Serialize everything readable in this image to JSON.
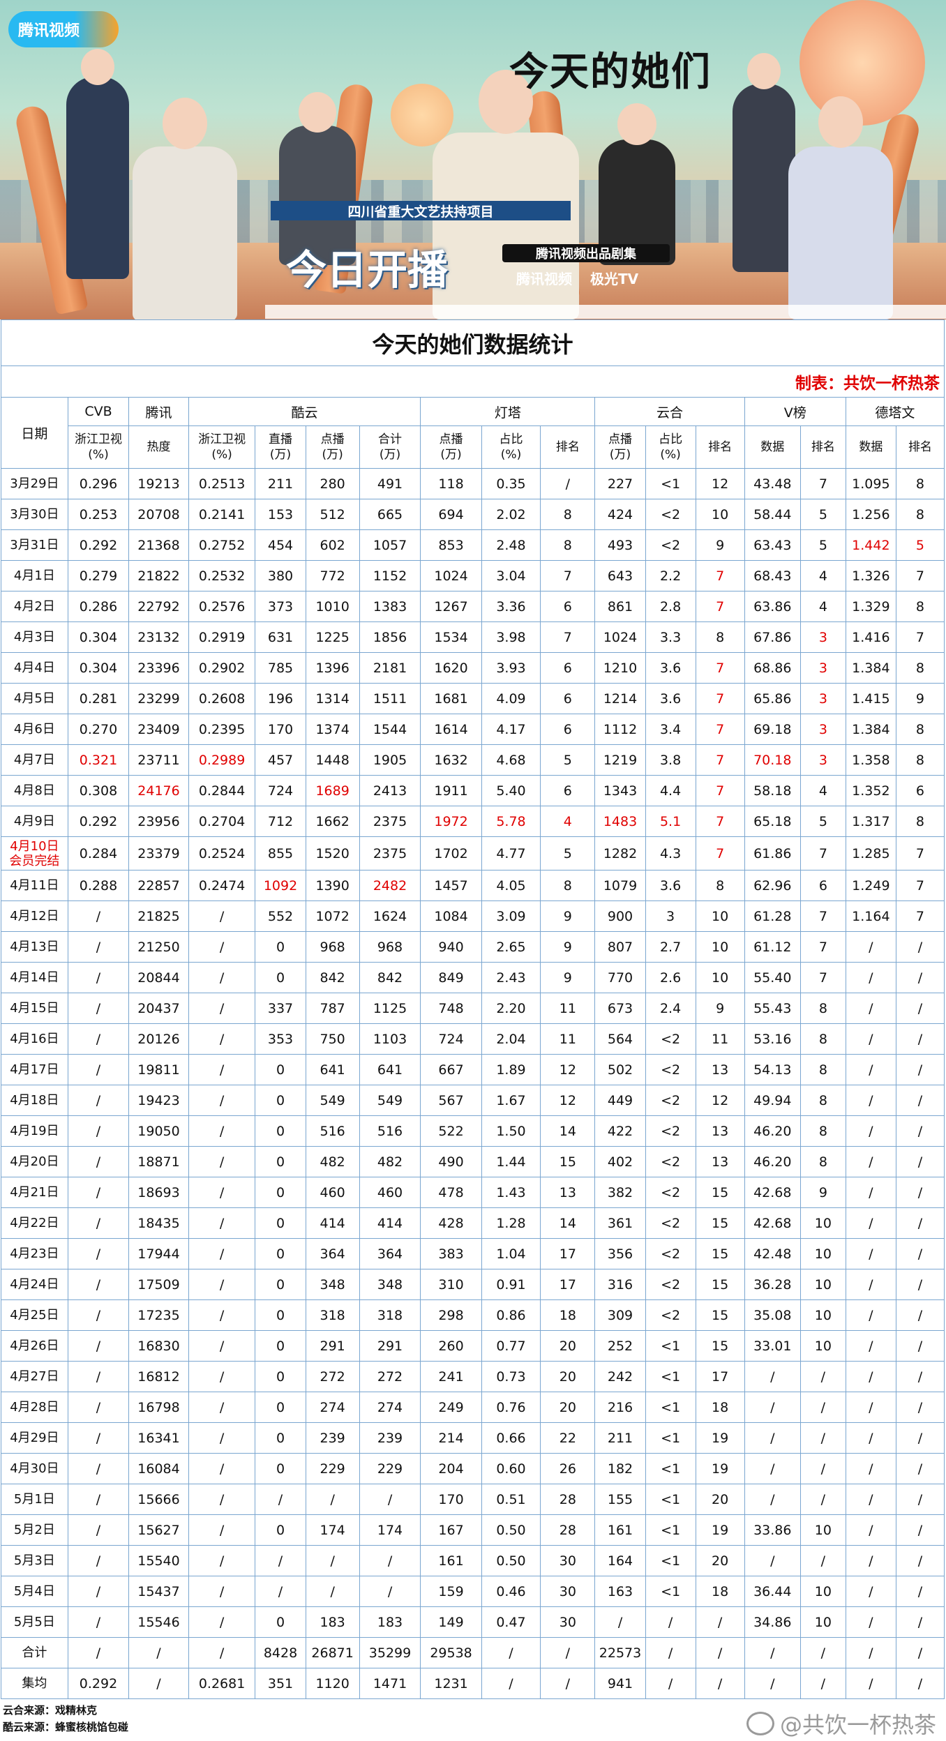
{
  "poster": {
    "platform_logo": "腾讯视频",
    "show_title": "今天的她们",
    "project_label": "四川省重大文艺扶持项目",
    "production_label": "腾讯视频出品剧集",
    "premiere_text": "今日开播",
    "brand_1": "腾讯视频",
    "brand_2": "极光TV"
  },
  "table_title": "今天的她们数据统计",
  "maker": "制表：共饮一杯热茶",
  "headers": {
    "date": "日期",
    "groups": [
      "CVB",
      "腾讯",
      "酷云",
      "灯塔",
      "云合",
      "V榜",
      "德塔文"
    ],
    "sub": [
      "浙江卫视\n(%)",
      "热度",
      "浙江卫视\n(%)",
      "直播\n(万)",
      "点播\n(万)",
      "合计\n(万)",
      "点播\n(万)",
      "占比\n(%)",
      "排名",
      "点播\n(万)",
      "占比\n(%)",
      "排名",
      "数据",
      "排名",
      "数据",
      "排名"
    ]
  },
  "red_color": "#e00000",
  "rows": [
    {
      "date": "3月29日",
      "c": [
        "0.296",
        "19213",
        "0.2513",
        "211",
        "280",
        "491",
        "118",
        "0.35",
        "/",
        "227",
        "<1",
        "12",
        "43.48",
        "7",
        "1.095",
        "8"
      ],
      "red": []
    },
    {
      "date": "3月30日",
      "c": [
        "0.253",
        "20708",
        "0.2141",
        "153",
        "512",
        "665",
        "694",
        "2.02",
        "8",
        "424",
        "<2",
        "10",
        "58.44",
        "5",
        "1.256",
        "8"
      ],
      "red": []
    },
    {
      "date": "3月31日",
      "c": [
        "0.292",
        "21368",
        "0.2752",
        "454",
        "602",
        "1057",
        "853",
        "2.48",
        "8",
        "493",
        "<2",
        "9",
        "63.43",
        "5",
        "1.442",
        "5"
      ],
      "red": [
        14,
        15
      ]
    },
    {
      "date": "4月1日",
      "c": [
        "0.279",
        "21822",
        "0.2532",
        "380",
        "772",
        "1152",
        "1024",
        "3.04",
        "7",
        "643",
        "2.2",
        "7",
        "68.43",
        "4",
        "1.326",
        "7"
      ],
      "red": [
        11
      ]
    },
    {
      "date": "4月2日",
      "c": [
        "0.286",
        "22792",
        "0.2576",
        "373",
        "1010",
        "1383",
        "1267",
        "3.36",
        "6",
        "861",
        "2.8",
        "7",
        "63.86",
        "4",
        "1.329",
        "8"
      ],
      "red": [
        11
      ]
    },
    {
      "date": "4月3日",
      "c": [
        "0.304",
        "23132",
        "0.2919",
        "631",
        "1225",
        "1856",
        "1534",
        "3.98",
        "7",
        "1024",
        "3.3",
        "8",
        "67.86",
        "3",
        "1.416",
        "7"
      ],
      "red": [
        13
      ]
    },
    {
      "date": "4月4日",
      "c": [
        "0.304",
        "23396",
        "0.2902",
        "785",
        "1396",
        "2181",
        "1620",
        "3.93",
        "6",
        "1210",
        "3.6",
        "7",
        "68.86",
        "3",
        "1.384",
        "8"
      ],
      "red": [
        11,
        13
      ]
    },
    {
      "date": "4月5日",
      "c": [
        "0.281",
        "23299",
        "0.2608",
        "196",
        "1314",
        "1511",
        "1681",
        "4.09",
        "6",
        "1214",
        "3.6",
        "7",
        "65.86",
        "3",
        "1.415",
        "9"
      ],
      "red": [
        11,
        13
      ]
    },
    {
      "date": "4月6日",
      "c": [
        "0.270",
        "23409",
        "0.2395",
        "170",
        "1374",
        "1544",
        "1614",
        "4.17",
        "6",
        "1112",
        "3.4",
        "7",
        "69.18",
        "3",
        "1.384",
        "8"
      ],
      "red": [
        11,
        13
      ]
    },
    {
      "date": "4月7日",
      "c": [
        "0.321",
        "23711",
        "0.2989",
        "457",
        "1448",
        "1905",
        "1632",
        "4.68",
        "5",
        "1219",
        "3.8",
        "7",
        "70.18",
        "3",
        "1.358",
        "8"
      ],
      "red": [
        0,
        2,
        11,
        12,
        13
      ]
    },
    {
      "date": "4月8日",
      "c": [
        "0.308",
        "24176",
        "0.2844",
        "724",
        "1689",
        "2413",
        "1911",
        "5.40",
        "6",
        "1343",
        "4.4",
        "7",
        "58.18",
        "4",
        "1.352",
        "6"
      ],
      "red": [
        1,
        4,
        11
      ]
    },
    {
      "date": "4月9日",
      "c": [
        "0.292",
        "23956",
        "0.2704",
        "712",
        "1662",
        "2375",
        "1972",
        "5.78",
        "4",
        "1483",
        "5.1",
        "7",
        "65.18",
        "5",
        "1.317",
        "8"
      ],
      "red": [
        6,
        7,
        8,
        9,
        10,
        11
      ]
    },
    {
      "date": "4月10日\n会员完结",
      "c": [
        "0.284",
        "23379",
        "0.2524",
        "855",
        "1520",
        "2375",
        "1702",
        "4.77",
        "5",
        "1282",
        "4.3",
        "7",
        "61.86",
        "7",
        "1.285",
        "7"
      ],
      "red": [
        11
      ],
      "date_red": true
    },
    {
      "date": "4月11日",
      "c": [
        "0.288",
        "22857",
        "0.2474",
        "1092",
        "1390",
        "2482",
        "1457",
        "4.05",
        "8",
        "1079",
        "3.6",
        "8",
        "62.96",
        "6",
        "1.249",
        "7"
      ],
      "red": [
        3,
        5
      ]
    },
    {
      "date": "4月12日",
      "c": [
        "/",
        "21825",
        "/",
        "552",
        "1072",
        "1624",
        "1084",
        "3.09",
        "9",
        "900",
        "3",
        "10",
        "61.28",
        "7",
        "1.164",
        "7"
      ],
      "red": []
    },
    {
      "date": "4月13日",
      "c": [
        "/",
        "21250",
        "/",
        "0",
        "968",
        "968",
        "940",
        "2.65",
        "9",
        "807",
        "2.7",
        "10",
        "61.12",
        "7",
        "/",
        "/"
      ],
      "red": []
    },
    {
      "date": "4月14日",
      "c": [
        "/",
        "20844",
        "/",
        "0",
        "842",
        "842",
        "849",
        "2.43",
        "9",
        "770",
        "2.6",
        "10",
        "55.40",
        "7",
        "/",
        "/"
      ],
      "red": []
    },
    {
      "date": "4月15日",
      "c": [
        "/",
        "20437",
        "/",
        "337",
        "787",
        "1125",
        "748",
        "2.20",
        "11",
        "673",
        "2.4",
        "9",
        "55.43",
        "8",
        "/",
        "/"
      ],
      "red": []
    },
    {
      "date": "4月16日",
      "c": [
        "/",
        "20126",
        "/",
        "353",
        "750",
        "1103",
        "724",
        "2.04",
        "11",
        "564",
        "<2",
        "11",
        "53.16",
        "8",
        "/",
        "/"
      ],
      "red": []
    },
    {
      "date": "4月17日",
      "c": [
        "/",
        "19811",
        "/",
        "0",
        "641",
        "641",
        "667",
        "1.89",
        "12",
        "502",
        "<2",
        "13",
        "54.13",
        "8",
        "/",
        "/"
      ],
      "red": []
    },
    {
      "date": "4月18日",
      "c": [
        "/",
        "19423",
        "/",
        "0",
        "549",
        "549",
        "567",
        "1.67",
        "12",
        "449",
        "<2",
        "12",
        "49.94",
        "8",
        "/",
        "/"
      ],
      "red": []
    },
    {
      "date": "4月19日",
      "c": [
        "/",
        "19050",
        "/",
        "0",
        "516",
        "516",
        "522",
        "1.50",
        "14",
        "422",
        "<2",
        "13",
        "46.20",
        "8",
        "/",
        "/"
      ],
      "red": []
    },
    {
      "date": "4月20日",
      "c": [
        "/",
        "18871",
        "/",
        "0",
        "482",
        "482",
        "490",
        "1.44",
        "15",
        "402",
        "<2",
        "13",
        "46.20",
        "8",
        "/",
        "/"
      ],
      "red": []
    },
    {
      "date": "4月21日",
      "c": [
        "/",
        "18693",
        "/",
        "0",
        "460",
        "460",
        "478",
        "1.43",
        "13",
        "382",
        "<2",
        "15",
        "42.68",
        "9",
        "/",
        "/"
      ],
      "red": []
    },
    {
      "date": "4月22日",
      "c": [
        "/",
        "18435",
        "/",
        "0",
        "414",
        "414",
        "428",
        "1.28",
        "14",
        "361",
        "<2",
        "15",
        "42.68",
        "10",
        "/",
        "/"
      ],
      "red": []
    },
    {
      "date": "4月23日",
      "c": [
        "/",
        "17944",
        "/",
        "0",
        "364",
        "364",
        "383",
        "1.04",
        "17",
        "356",
        "<2",
        "15",
        "42.48",
        "10",
        "/",
        "/"
      ],
      "red": []
    },
    {
      "date": "4月24日",
      "c": [
        "/",
        "17509",
        "/",
        "0",
        "348",
        "348",
        "310",
        "0.91",
        "17",
        "316",
        "<2",
        "15",
        "36.28",
        "10",
        "/",
        "/"
      ],
      "red": []
    },
    {
      "date": "4月25日",
      "c": [
        "/",
        "17235",
        "/",
        "0",
        "318",
        "318",
        "298",
        "0.86",
        "18",
        "309",
        "<2",
        "15",
        "35.08",
        "10",
        "/",
        "/"
      ],
      "red": []
    },
    {
      "date": "4月26日",
      "c": [
        "/",
        "16830",
        "/",
        "0",
        "291",
        "291",
        "260",
        "0.77",
        "20",
        "252",
        "<1",
        "15",
        "33.01",
        "10",
        "/",
        "/"
      ],
      "red": []
    },
    {
      "date": "4月27日",
      "c": [
        "/",
        "16812",
        "/",
        "0",
        "272",
        "272",
        "241",
        "0.73",
        "20",
        "242",
        "<1",
        "17",
        "/",
        "/",
        "/",
        "/"
      ],
      "red": []
    },
    {
      "date": "4月28日",
      "c": [
        "/",
        "16798",
        "/",
        "0",
        "274",
        "274",
        "249",
        "0.76",
        "20",
        "216",
        "<1",
        "18",
        "/",
        "/",
        "/",
        "/"
      ],
      "red": []
    },
    {
      "date": "4月29日",
      "c": [
        "/",
        "16341",
        "/",
        "0",
        "239",
        "239",
        "214",
        "0.66",
        "22",
        "211",
        "<1",
        "19",
        "/",
        "/",
        "/",
        "/"
      ],
      "red": []
    },
    {
      "date": "4月30日",
      "c": [
        "/",
        "16084",
        "/",
        "0",
        "229",
        "229",
        "204",
        "0.60",
        "26",
        "182",
        "<1",
        "19",
        "/",
        "/",
        "/",
        "/"
      ],
      "red": []
    },
    {
      "date": "5月1日",
      "c": [
        "/",
        "15666",
        "/",
        "/",
        "/",
        "/",
        "170",
        "0.51",
        "28",
        "155",
        "<1",
        "20",
        "/",
        "/",
        "/",
        "/"
      ],
      "red": []
    },
    {
      "date": "5月2日",
      "c": [
        "/",
        "15627",
        "/",
        "0",
        "174",
        "174",
        "167",
        "0.50",
        "28",
        "161",
        "<1",
        "19",
        "33.86",
        "10",
        "/",
        "/"
      ],
      "red": []
    },
    {
      "date": "5月3日",
      "c": [
        "/",
        "15540",
        "/",
        "/",
        "/",
        "/",
        "161",
        "0.50",
        "30",
        "164",
        "<1",
        "20",
        "/",
        "/",
        "/",
        "/"
      ],
      "red": []
    },
    {
      "date": "5月4日",
      "c": [
        "/",
        "15437",
        "/",
        "/",
        "/",
        "/",
        "159",
        "0.46",
        "30",
        "163",
        "<1",
        "18",
        "36.44",
        "10",
        "/",
        "/"
      ],
      "red": []
    },
    {
      "date": "5月5日",
      "c": [
        "/",
        "15546",
        "/",
        "0",
        "183",
        "183",
        "149",
        "0.47",
        "30",
        "/",
        "/",
        "/",
        "34.86",
        "10",
        "/",
        "/"
      ],
      "red": []
    },
    {
      "date": "合计",
      "c": [
        "/",
        "/",
        "/",
        "8428",
        "26871",
        "35299",
        "29538",
        "/",
        "/",
        "22573",
        "/",
        "/",
        "/",
        "/",
        "/",
        "/"
      ],
      "red": []
    },
    {
      "date": "集均",
      "c": [
        "0.292",
        "/",
        "0.2681",
        "351",
        "1120",
        "1471",
        "1231",
        "/",
        "/",
        "941",
        "/",
        "/",
        "/",
        "/",
        "/",
        "/"
      ],
      "red": []
    }
  ],
  "notes": [
    "云合来源：戏精林克",
    "酷云来源：蜂蜜核桃馅包碰"
  ],
  "watermark": "@共饮一杯热茶"
}
